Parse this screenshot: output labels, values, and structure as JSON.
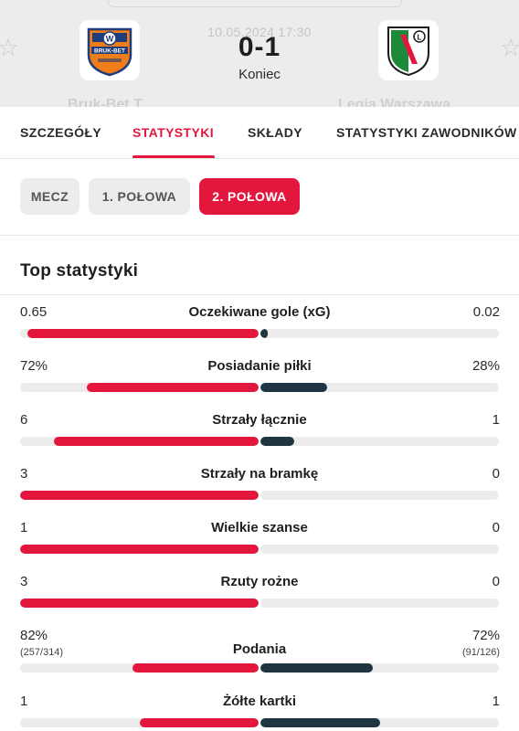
{
  "header": {
    "date": "10.05.2024 17:30",
    "score": "0-1",
    "status": "Koniec",
    "home_team": {
      "name": "Bruk-Bet T",
      "logo_text": "BRUK-BET",
      "logo_color": "#ef7d1a"
    },
    "away_team": {
      "name": "Legia Warszawa",
      "logo_color": "#1d8a3a"
    }
  },
  "tabs": [
    {
      "label": "SZCZEGÓŁY",
      "active": false
    },
    {
      "label": "STATYSTYKI",
      "active": true
    },
    {
      "label": "SKŁADY",
      "active": false
    },
    {
      "label": "STATYSTYKI ZAWODNIKÓW",
      "active": false
    }
  ],
  "periods": [
    {
      "label": "MECZ",
      "active": false
    },
    {
      "label": "1. POŁOWA",
      "active": false
    },
    {
      "label": "2. POŁOWA",
      "active": true
    }
  ],
  "section_title": "Top statystyki",
  "stats": [
    {
      "label": "Oczekiwane gole (xG)",
      "home": "0.65",
      "away": "0.02",
      "home_share": 0.97,
      "away_share": 0.03
    },
    {
      "label": "Posiadanie piłki",
      "home": "72%",
      "away": "28%",
      "home_share": 0.72,
      "away_share": 0.28
    },
    {
      "label": "Strzały łącznie",
      "home": "6",
      "away": "1",
      "home_share": 0.857,
      "away_share": 0.143
    },
    {
      "label": "Strzały na bramkę",
      "home": "3",
      "away": "0",
      "home_share": 1.0,
      "away_share": 0.0
    },
    {
      "label": "Wielkie szanse",
      "home": "1",
      "away": "0",
      "home_share": 1.0,
      "away_share": 0.0
    },
    {
      "label": "Rzuty rożne",
      "home": "3",
      "away": "0",
      "home_share": 1.0,
      "away_share": 0.0
    },
    {
      "label": "Podania",
      "home": "82%",
      "away": "72%",
      "home_sub": "(257/314)",
      "away_sub": "(91/126)",
      "home_share": 0.53,
      "away_share": 0.47
    },
    {
      "label": "Żółte kartki",
      "home": "1",
      "away": "1",
      "home_share": 0.5,
      "away_share": 0.5
    }
  ],
  "colors": {
    "accent": "#e3173e",
    "away_bar": "#1f3541",
    "track": "#ececec"
  }
}
